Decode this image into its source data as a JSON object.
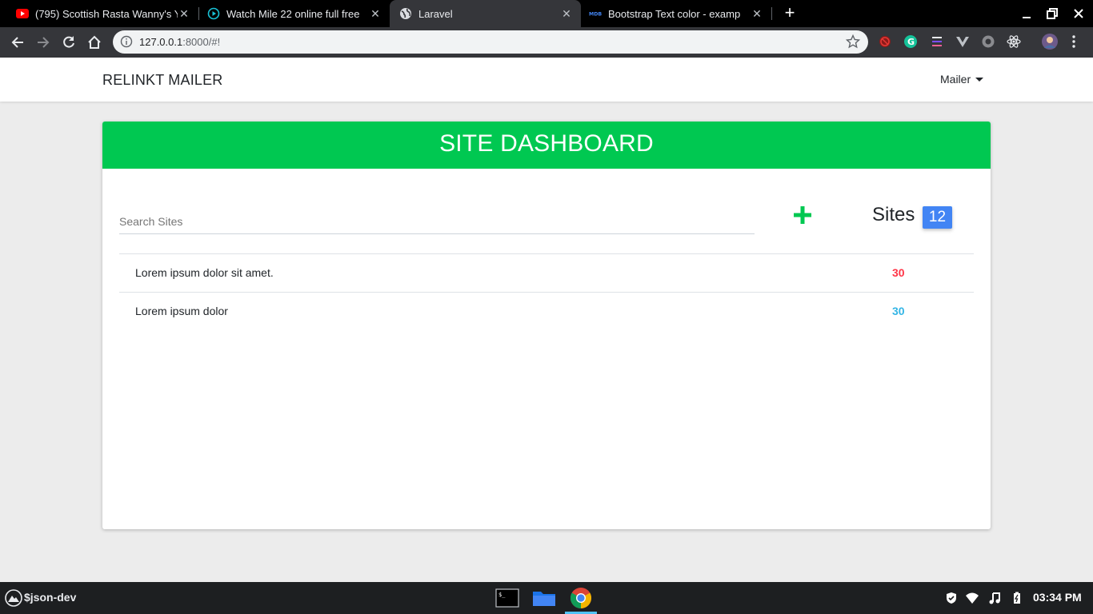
{
  "browser": {
    "tabs": [
      {
        "title": "(795) Scottish Rasta Wanny's Y",
        "favicon": "youtube-icon"
      },
      {
        "title": "Watch Mile 22 online full free",
        "favicon": "play-circle-icon"
      },
      {
        "title": "Laravel",
        "favicon": "globe-icon"
      },
      {
        "title": "Bootstrap Text color - examp",
        "favicon": "mdb-icon"
      }
    ],
    "url_host": "127.0.0.1",
    "url_rest": ":8000/#!"
  },
  "app": {
    "brand": "RELINKT MAILER",
    "nav_menu": "Mailer"
  },
  "dashboard": {
    "title": "SITE DASHBOARD",
    "search_placeholder": "Search Sites",
    "sites_label": "Sites",
    "sites_count": "12",
    "rows": [
      {
        "name": "Lorem ipsum dolor sit amet.",
        "count": "30",
        "color": "#ff3547"
      },
      {
        "name": "Lorem ipsum dolor",
        "count": "30",
        "color": "#33b5e5"
      }
    ],
    "accent_color": "#00c851",
    "badge_color": "#4285f4"
  },
  "taskbar": {
    "user": "$json-dev",
    "time": "03:34 PM"
  }
}
